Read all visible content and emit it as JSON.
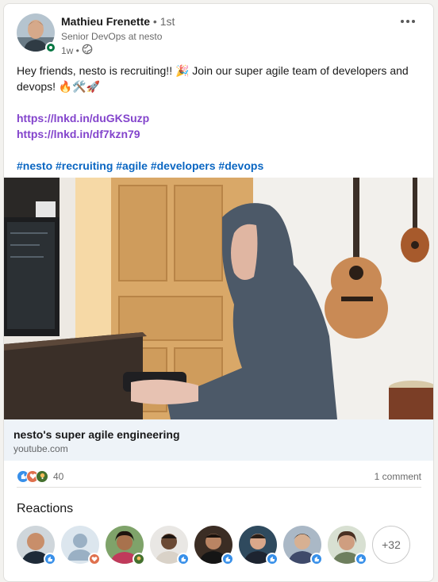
{
  "post": {
    "author_name": "Mathieu Frenette",
    "degree": " • 1st",
    "author_headline": "Senior DevOps at nesto",
    "time": "1w •",
    "text_line1": "Hey friends, nesto is recruiting!! 🎉 Join our super agile team of developers and devops! 🔥🛠️🚀",
    "link1": "https://lnkd.in/duGKSuzp",
    "link2": "https://lnkd.in/df7kzn79",
    "hashtags": "#nesto #recruiting #agile #developers #devops"
  },
  "link_preview": {
    "title": "nesto's super agile engineering",
    "source": "youtube.com"
  },
  "social": {
    "reaction_count": "40",
    "comment_count": "1 comment"
  },
  "reactions": {
    "title": "Reactions",
    "more": "+32",
    "people": [
      {
        "reaction": "like",
        "color": "#6b4b3a"
      },
      {
        "reaction": "love",
        "color": "#9aa9b8"
      },
      {
        "reaction": "insightful",
        "color": "#6d4b33"
      },
      {
        "reaction": "like",
        "color": "#3a2a24"
      },
      {
        "reaction": "like",
        "color": "#4a3428"
      },
      {
        "reaction": "like",
        "color": "#2c2f3a"
      },
      {
        "reaction": "like",
        "color": "#5a4a48"
      },
      {
        "reaction": "like",
        "color": "#7a5a45"
      }
    ]
  },
  "colors": {
    "like": "#378fe9",
    "love": "#df704d",
    "insightful": "#44712e",
    "hashtag": "#0a66c2",
    "link": "#8344cc"
  }
}
